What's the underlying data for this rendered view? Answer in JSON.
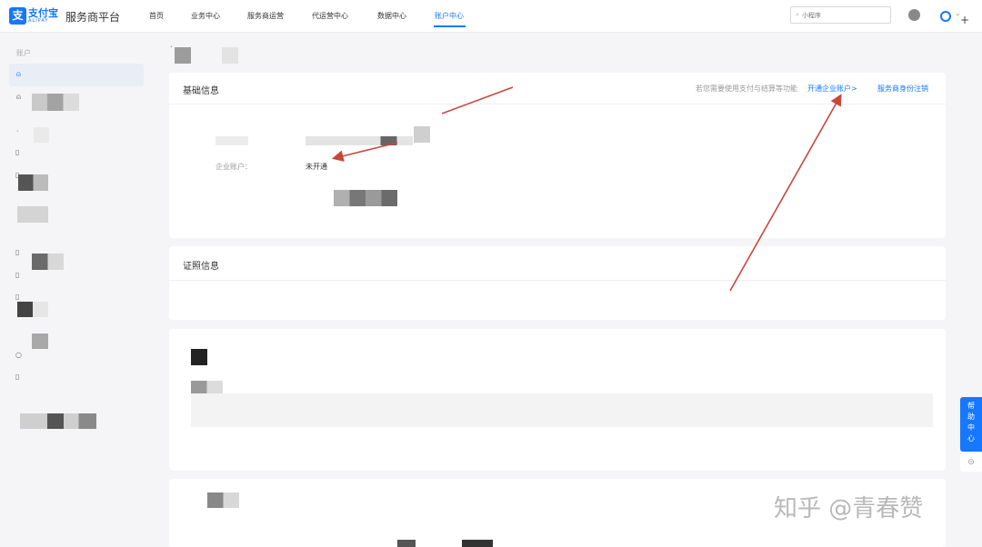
{
  "header": {
    "logo_cn": "支付宝",
    "logo_en": "ALIPAY",
    "platform_title": "服务商平台",
    "nav": [
      {
        "label": "首页"
      },
      {
        "label": "业务中心"
      },
      {
        "label": "服务商运营"
      },
      {
        "label": "代运营中心"
      },
      {
        "label": "数据中心"
      },
      {
        "label": "账户中心",
        "active": true
      }
    ],
    "search_placeholder": "小程序",
    "accent_color": "#1677ff"
  },
  "sidebar": {
    "group_label": "账户"
  },
  "basic_info": {
    "title": "基础信息",
    "hint": "若您需要使用支付与结算等功能",
    "open_enterprise_link": "开通企业账户>",
    "deregister_link": "服务商身份注销",
    "fields": [
      {
        "label": "企业账户：",
        "value": "未开通"
      }
    ]
  },
  "license_info": {
    "title": "证照信息"
  },
  "help": {
    "label": "帮助中心"
  },
  "watermark": "知乎 @青春赞"
}
